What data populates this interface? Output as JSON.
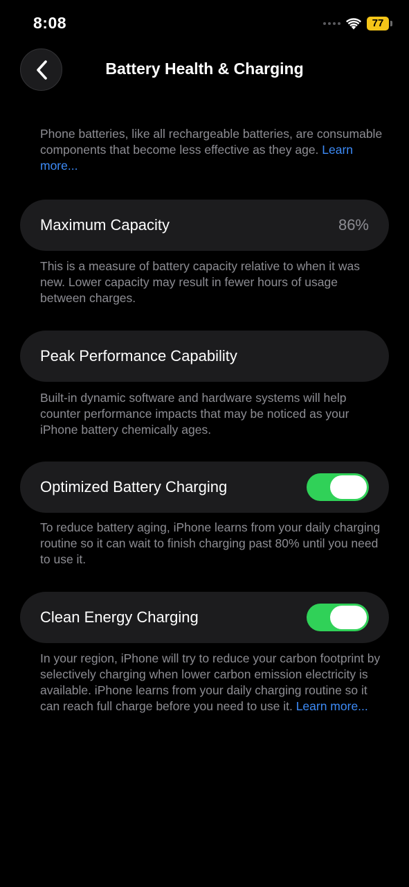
{
  "status_bar": {
    "time": "8:08",
    "battery_level": "77",
    "icons": [
      "signal-dots-icon",
      "wifi-icon",
      "battery-icon"
    ]
  },
  "nav": {
    "title": "Battery Health & Charging",
    "back_icon": "chevron-left-icon"
  },
  "intro": {
    "text": "Phone batteries, like all rechargeable batteries, are consumable components that become less effective as they age. ",
    "link": "Learn more..."
  },
  "maximum_capacity": {
    "label": "Maximum Capacity",
    "value": "86%",
    "footnote": "This is a measure of battery capacity relative to when it was new. Lower capacity may result in fewer hours of usage between charges."
  },
  "peak_performance": {
    "label": "Peak Performance Capability",
    "footnote": "Built-in dynamic software and hardware systems will help counter performance impacts that may be noticed as your iPhone battery chemically ages."
  },
  "optimized_charging": {
    "label": "Optimized Battery Charging",
    "enabled": true,
    "footnote": "To reduce battery aging, iPhone learns from your daily charging routine so it can wait to finish charging past 80% until you need to use it."
  },
  "clean_energy": {
    "label": "Clean Energy Charging",
    "enabled": true,
    "footnote": "In your region, iPhone will try to reduce your carbon footprint by selectively charging when lower carbon emission electricity is available. iPhone learns from your daily charging routine so it can reach full charge before you need to use it. ",
    "link": "Learn more..."
  },
  "colors": {
    "background": "#000000",
    "cell": "#1c1c1e",
    "secondary_text": "#8d8d93",
    "link": "#3d8bf7",
    "toggle_on": "#30d158",
    "battery_low_power": "#f5c518"
  }
}
